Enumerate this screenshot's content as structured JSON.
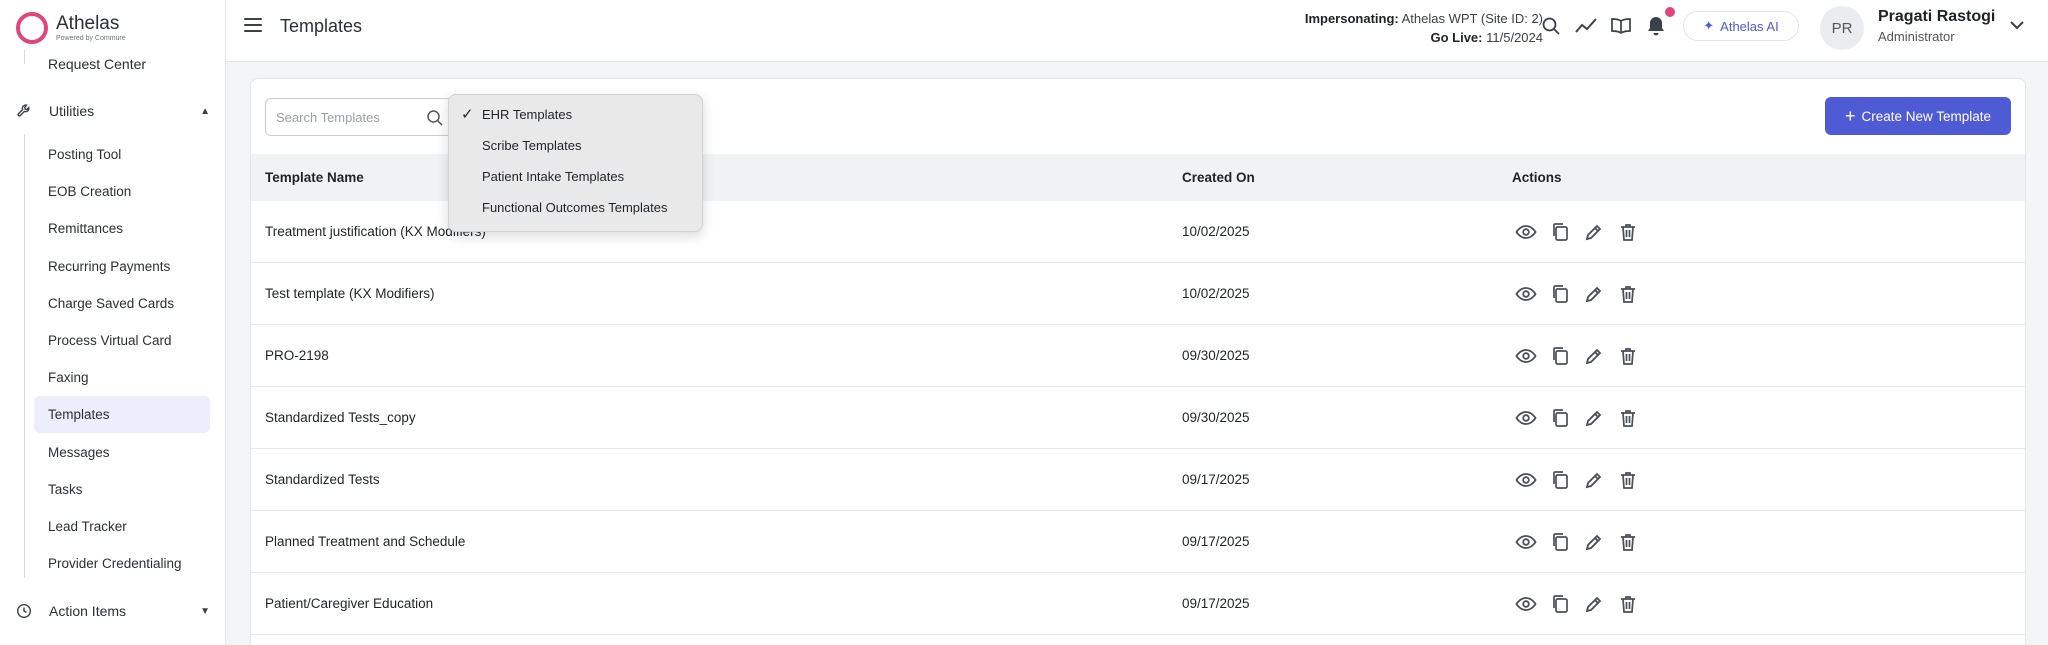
{
  "brand": {
    "name": "Athelas",
    "sub": "Powered by Commure"
  },
  "sidebar": {
    "top_item": "Request Center",
    "utilities": {
      "label": "Utilities",
      "items": [
        "Posting Tool",
        "EOB Creation",
        "Remittances",
        "Recurring Payments",
        "Charge Saved Cards",
        "Process Virtual Card",
        "Faxing",
        "Templates",
        "Messages",
        "Tasks",
        "Lead Tracker",
        "Provider Credentialing"
      ],
      "active": "Templates"
    },
    "action_items": {
      "label": "Action Items"
    }
  },
  "header": {
    "title": "Templates",
    "impersonating_label": "Impersonating:",
    "impersonating_value": "Athelas WPT (Site ID: 2)",
    "golive_label": "Go Live:",
    "golive_value": "11/5/2024",
    "ai_label": "Athelas AI",
    "avatar_initials": "PR",
    "user_name": "Pragati Rastogi",
    "user_role": "Administrator"
  },
  "toolbar": {
    "search_placeholder": "Search Templates",
    "create_label": "Create New Template"
  },
  "dropdown": {
    "options": [
      "EHR Templates",
      "Scribe Templates",
      "Patient Intake Templates",
      "Functional Outcomes Templates"
    ],
    "selected": "EHR Templates"
  },
  "table": {
    "headers": {
      "name": "Template Name",
      "created": "Created On",
      "actions": "Actions"
    },
    "rows": [
      {
        "name": "Treatment justification (KX Modifiers)",
        "created": "10/02/2025"
      },
      {
        "name": "Test template (KX Modifiers)",
        "created": "10/02/2025"
      },
      {
        "name": "PRO-2198",
        "created": "09/30/2025"
      },
      {
        "name": "Standardized Tests_copy",
        "created": "09/30/2025"
      },
      {
        "name": "Standardized Tests",
        "created": "09/17/2025"
      },
      {
        "name": "Planned Treatment and Schedule",
        "created": "09/17/2025"
      },
      {
        "name": "Patient/Caregiver Education",
        "created": "09/17/2025"
      }
    ]
  },
  "colors": {
    "accent": "#4f5bd5",
    "brand": "#e0457b",
    "active_bg": "#eceefb"
  }
}
